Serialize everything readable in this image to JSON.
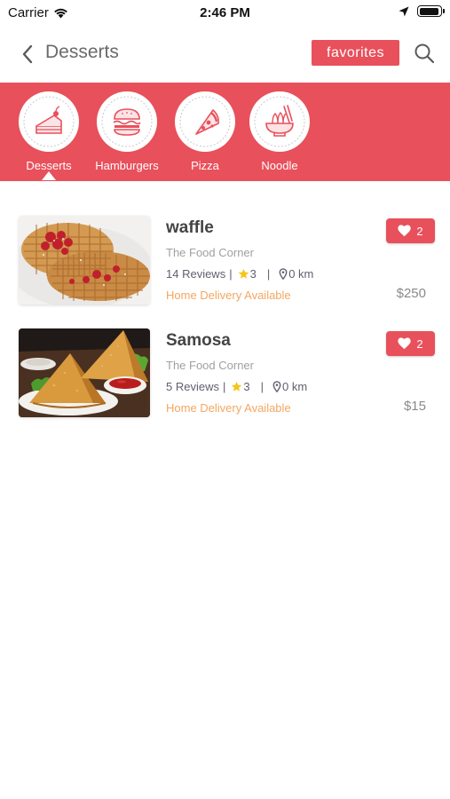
{
  "status_bar": {
    "carrier": "Carrier",
    "time": "2:46 PM",
    "battery_level": 0.95
  },
  "nav": {
    "title": "Desserts",
    "favorites_label": "favorites",
    "icons": {
      "back": "chevron-left-icon",
      "search": "search-icon"
    }
  },
  "colors": {
    "accent": "#e8505b",
    "delivery": "#f4a661",
    "star": "#f5c518"
  },
  "categories": [
    {
      "label": "Desserts",
      "icon": "cake-icon",
      "selected": true
    },
    {
      "label": "Hamburgers",
      "icon": "burger-icon",
      "selected": false
    },
    {
      "label": "Pizza",
      "icon": "pizza-icon",
      "selected": false
    },
    {
      "label": "Noodle",
      "icon": "noodle-icon",
      "selected": false
    }
  ],
  "items": [
    {
      "name": "waffle",
      "restaurant": "The Food Corner",
      "reviews": "14 Reviews",
      "rating": "3",
      "distance": "0 km",
      "delivery": "Home Delivery Available",
      "likes": "2",
      "price": "$250",
      "image": "waffle-photo"
    },
    {
      "name": "Samosa",
      "restaurant": "The Food Corner",
      "reviews": "5 Reviews",
      "rating": "3",
      "distance": "0 km",
      "delivery": "Home Delivery Available",
      "likes": "2",
      "price": "$15",
      "image": "samosa-photo"
    }
  ],
  "separators": {
    "bar": "|"
  }
}
